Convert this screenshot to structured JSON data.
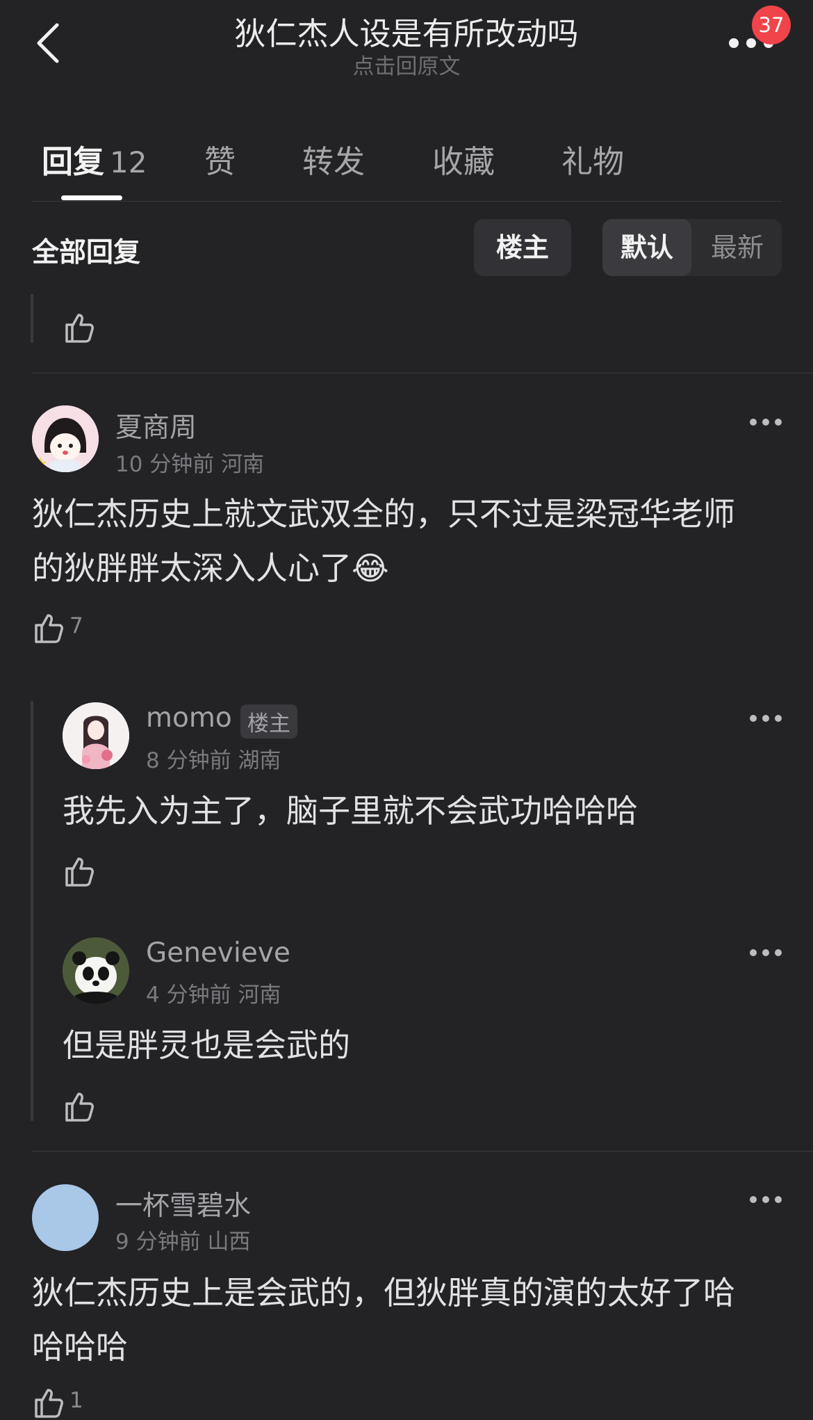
{
  "header": {
    "title": "狄仁杰人设是有所改动吗",
    "subtitle": "点击回原文",
    "badge_count": "37"
  },
  "tabs": [
    {
      "label": "回复",
      "count": "12"
    },
    {
      "label": "赞"
    },
    {
      "label": "转发"
    },
    {
      "label": "收藏"
    },
    {
      "label": "礼物"
    }
  ],
  "filter": {
    "all_replies": "全部回复",
    "op_only": "楼主",
    "sort_default": "默认",
    "sort_newest": "最新"
  },
  "comments": [
    {
      "user": "夏商周",
      "time": "10 分钟前",
      "location": "河南",
      "text_line1": "狄仁杰历史上就文武双全的，只不过是梁冠华老师",
      "text_line2": "的狄胖胖太深入人心了",
      "emoji": "😂",
      "likes": "7"
    },
    {
      "user": "momo",
      "op_tag": "楼主",
      "time": "8 分钟前",
      "location": "湖南",
      "text": "我先入为主了，脑子里就不会武功哈哈哈"
    },
    {
      "user": "Genevieve",
      "time": "4 分钟前",
      "location": "河南",
      "text": "但是胖灵也是会武的"
    },
    {
      "user": "一杯雪碧水",
      "time": "9 分钟前",
      "location": "山西",
      "text_line1": "狄仁杰历史上是会武的，但狄胖真的演的太好了哈",
      "text_line2": "哈哈哈",
      "likes": "1"
    }
  ],
  "colors": {
    "background": "#232326",
    "badge": "#f0444a",
    "avatar_placeholder": "#a9c7e6"
  }
}
